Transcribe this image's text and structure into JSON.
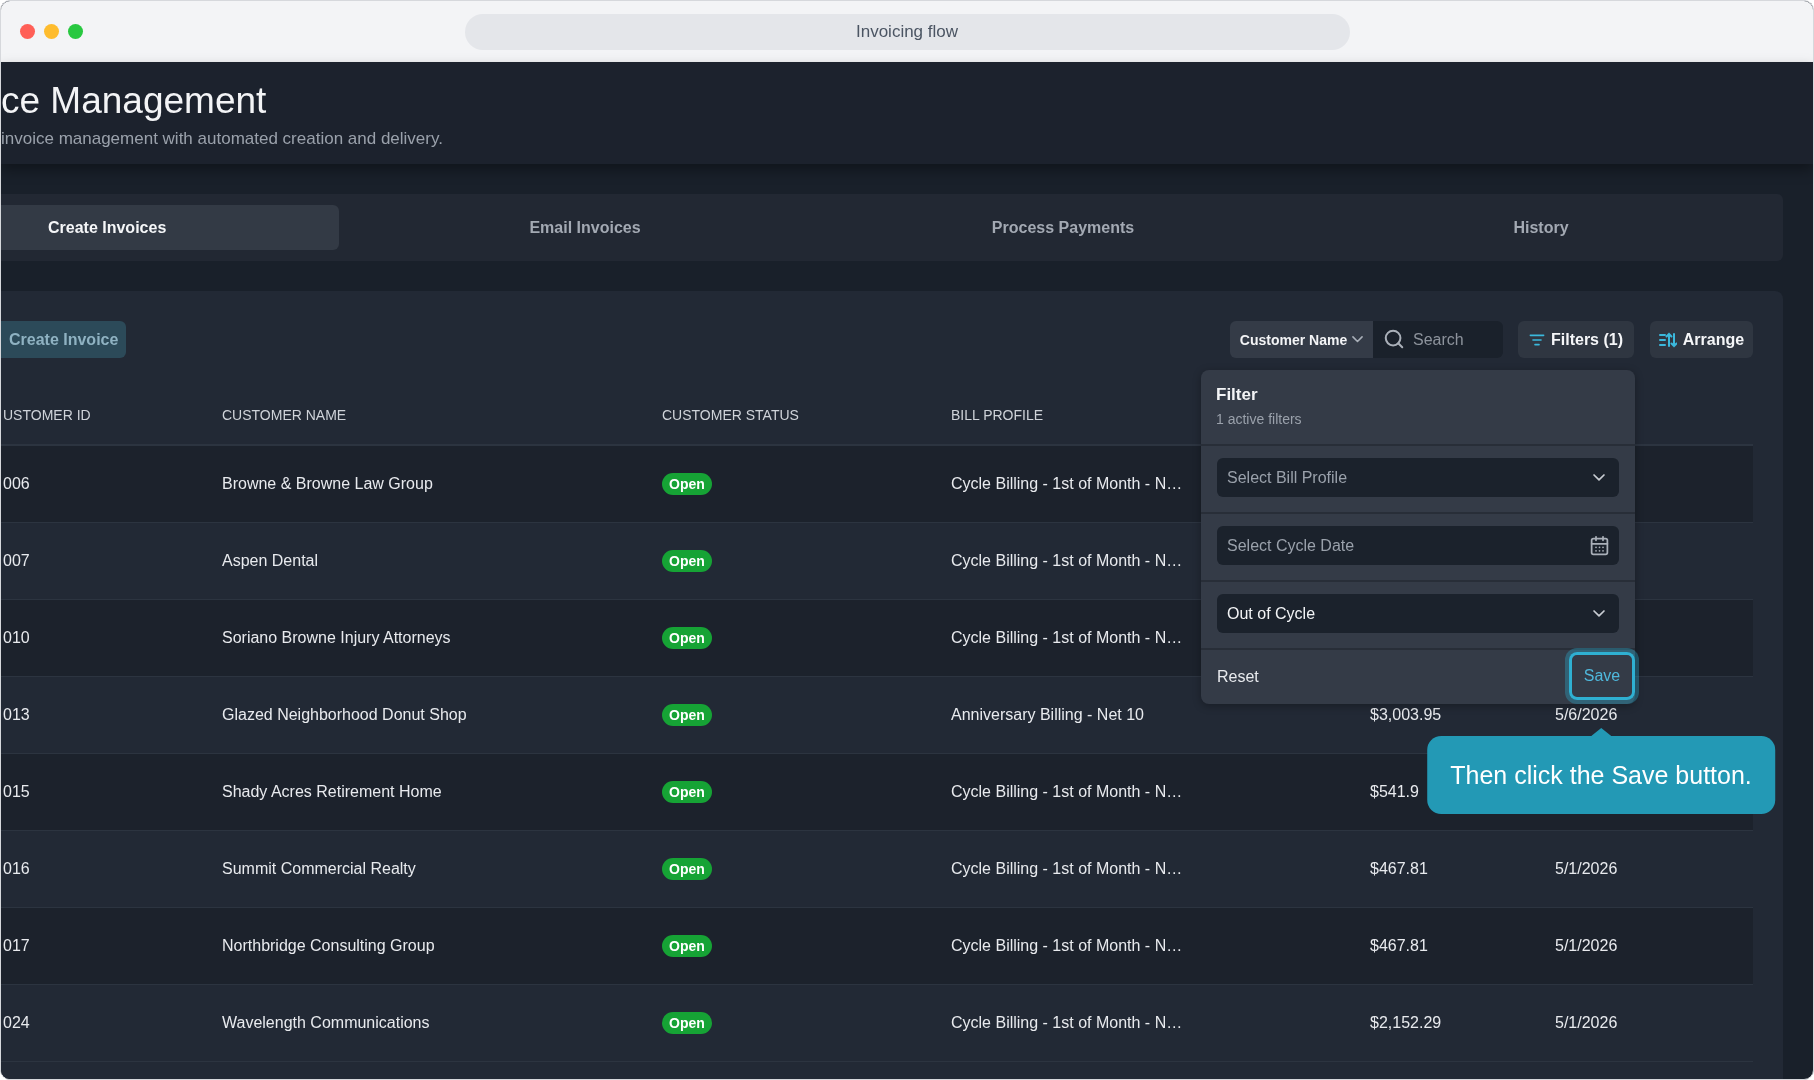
{
  "window": {
    "title": "Invoicing flow"
  },
  "header": {
    "title": "ce Management",
    "subtitle": "invoice management with automated creation and delivery."
  },
  "tabs": [
    {
      "label": "Create Invoices",
      "selected": true
    },
    {
      "label": "Email Invoices",
      "selected": false
    },
    {
      "label": "Process Payments",
      "selected": false
    },
    {
      "label": "History",
      "selected": false
    }
  ],
  "toolbar": {
    "create_button": "Create Invoice",
    "search_scope": "Customer Name",
    "search": {
      "placeholder": "Search"
    },
    "filters_button": "Filters (1)",
    "arrange_button": "Arrange"
  },
  "table": {
    "columns": [
      "USTOMER ID",
      "CUSTOMER NAME",
      "CUSTOMER STATUS",
      "BILL PROFILE"
    ],
    "rows": [
      {
        "customer_id": "006",
        "customer_name": "Browne & Browne Law Group",
        "status": "Open",
        "bill_profile": "Cycle Billing - 1st of Month - N…"
      },
      {
        "customer_id": "007",
        "customer_name": "Aspen Dental",
        "status": "Open",
        "bill_profile": "Cycle Billing - 1st of Month - N…"
      },
      {
        "customer_id": "010",
        "customer_name": "Soriano Browne Injury Attorneys",
        "status": "Open",
        "bill_profile": "Cycle Billing - 1st of Month - N…"
      },
      {
        "customer_id": "013",
        "customer_name": "Glazed Neighborhood Donut Shop",
        "status": "Open",
        "bill_profile": "Anniversary Billing - Net 10",
        "column_5": "$3,003.95",
        "column_6": "5/6/2026"
      },
      {
        "customer_id": "015",
        "customer_name": "Shady Acres Retirement Home",
        "status": "Open",
        "bill_profile": "Cycle Billing - 1st of Month - N…",
        "column_5": "$541.9"
      },
      {
        "customer_id": "016",
        "customer_name": "Summit Commercial Realty",
        "status": "Open",
        "bill_profile": "Cycle Billing - 1st of Month - N…",
        "column_5": "$467.81",
        "column_6": "5/1/2026"
      },
      {
        "customer_id": "017",
        "customer_name": "Northbridge Consulting Group",
        "status": "Open",
        "bill_profile": "Cycle Billing - 1st of Month - N…",
        "column_5": "$467.81",
        "column_6": "5/1/2026"
      },
      {
        "customer_id": "024",
        "customer_name": "Wavelength Communications",
        "status": "Open",
        "bill_profile": "Cycle Billing - 1st of Month - N…",
        "column_5": "$2,152.29",
        "column_6": "5/1/2026"
      }
    ]
  },
  "filter_panel": {
    "title": "Filter",
    "subtitle": "1 active filters",
    "fields": [
      {
        "kind": "select",
        "placeholder": "Select Bill Profile"
      },
      {
        "kind": "date",
        "placeholder": "Select Cycle Date"
      },
      {
        "kind": "select",
        "value": "Out of Cycle"
      }
    ],
    "reset_button": "Reset",
    "save_button": {
      "label": "Save",
      "highlighted": true
    }
  },
  "tooltip": {
    "text": "Then click the Save button."
  }
}
